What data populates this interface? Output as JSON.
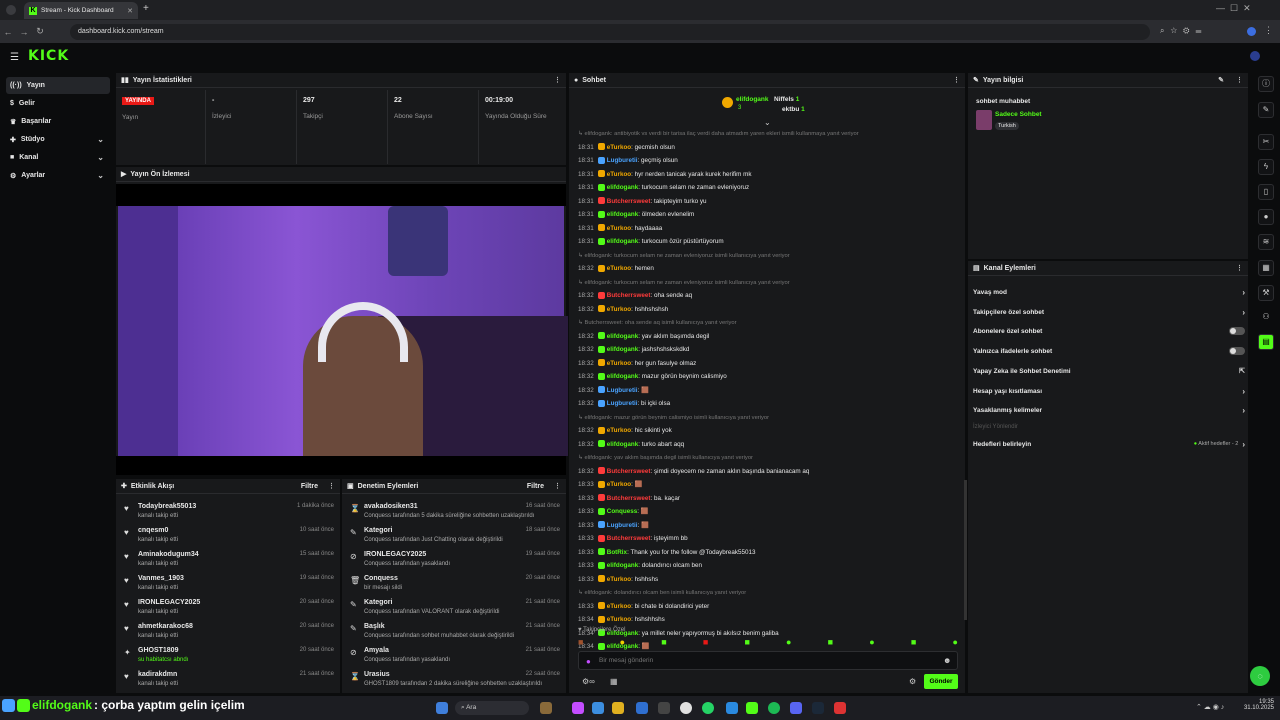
{
  "browser": {
    "tab_title": "Stream - Kick Dashboard",
    "url": "dashboard.kick.com/stream"
  },
  "brand": {
    "logo": "KICK",
    "accent": "#53fc18"
  },
  "sidebar": {
    "items": [
      {
        "label": "Yayın",
        "icon": "broadcast-icon"
      },
      {
        "label": "Gelir",
        "icon": "money-icon"
      },
      {
        "label": "Başarılar",
        "icon": "trophy-icon"
      },
      {
        "label": "Stüdyo",
        "icon": "studio-icon"
      },
      {
        "label": "Kanal",
        "icon": "channel-icon"
      },
      {
        "label": "Ayarlar",
        "icon": "gear-icon"
      }
    ]
  },
  "stats": {
    "title": "Yayın İstatistikleri",
    "cells": [
      {
        "value": "YAYINDA",
        "label": "Yayın"
      },
      {
        "value": "-",
        "label": "İzleyici"
      },
      {
        "value": "297",
        "label": "Takipçi"
      },
      {
        "value": "22",
        "label": "Abone Sayısı"
      },
      {
        "value": "00:19:00",
        "label": "Yayında Olduğu Süre"
      }
    ]
  },
  "preview": {
    "title": "Yayın Ön İzlemesi"
  },
  "activity": {
    "title": "Etkinlik Akışı",
    "filter": "Filtre",
    "rows": [
      {
        "name": "Todaybreak55013",
        "sub": "kanalı takip etti",
        "time": "1 dakika önce"
      },
      {
        "name": "cnqesm0",
        "sub": "kanalı takip etti",
        "time": "10 saat önce"
      },
      {
        "name": "Aminakodugum34",
        "sub": "kanalı takip etti",
        "time": "15 saat önce"
      },
      {
        "name": "Vanmes_1903",
        "sub": "kanalı takip etti",
        "time": "19 saat önce"
      },
      {
        "name": "IRONLEGACY2025",
        "sub": "kanalı takip etti",
        "time": "20 saat önce"
      },
      {
        "name": "ahmetkarakoc68",
        "sub": "kanalı takip etti",
        "time": "20 saat önce"
      },
      {
        "name": "GHOST1809",
        "sub": "su habitatcsı abndı",
        "time": "20 saat önce"
      },
      {
        "name": "kadirakdmn",
        "sub": "kanalı takip etti",
        "time": "21 saat önce"
      }
    ]
  },
  "moderation": {
    "title": "Denetim Eylemleri",
    "filter": "Filtre",
    "rows": [
      {
        "name": "avakadosiken31",
        "sub": "Conquess tarafından 5 dakika süreliğine sohbetten uzaklaştırıldı",
        "time": "16 saat önce"
      },
      {
        "name": "Kategori",
        "sub": "Conquess tarafından Just Chatting olarak değiştirildi",
        "time": "18 saat önce"
      },
      {
        "name": "IRONLEGACY2025",
        "sub": "Conquess tarafından yasaklandı",
        "time": "19 saat önce"
      },
      {
        "name": "Conquess",
        "sub": "bir mesajı sildi",
        "time": "20 saat önce"
      },
      {
        "name": "Kategori",
        "sub": "Conquess tarafından VALORANT olarak değiştirildi",
        "time": "21 saat önce"
      },
      {
        "name": "Başlık",
        "sub": "Conquess tarafından sohbet muhabbet olarak değiştirildi",
        "time": "21 saat önce"
      },
      {
        "name": "Amyala",
        "sub": "Conquess tarafından yasaklandı",
        "time": "21 saat önce"
      },
      {
        "name": "Urasius",
        "sub": "GHOST1809 tarafından 2 dakika süreliğine sohbetten uzaklaştırıldı",
        "time": "22 saat önce"
      }
    ]
  },
  "chat": {
    "title": "Sohbet",
    "pinned_user": "elifdogank",
    "pinned_count": "3",
    "top1": "Niffels",
    "top1n": "1",
    "top2": "ektbu",
    "top2n": "1",
    "followers_only": "Takipçilere Özel",
    "placeholder": "Bir mesaj gönderin",
    "send": "Gönder",
    "lines": [
      {
        "r": "elifdogank: antibiyotik vs verdi bir tarisa ilaç verdi daha atmadım yaren ekleri ismili kullanmaya yanıt veriyor"
      },
      {
        "t": "18:31",
        "u": "eTurkoo",
        "c": "#f0a800",
        "m": "gecmish olsun"
      },
      {
        "t": "18:31",
        "u": "Lugburetii",
        "c": "#4aa3ff",
        "m": "geçmiş olsun"
      },
      {
        "t": "18:31",
        "u": "eTurkoo",
        "c": "#f0a800",
        "m": "hyr nerden tanicak yarak kurek herifim mk"
      },
      {
        "t": "18:31",
        "u": "elifdogank",
        "c": "#53fc18",
        "m": "turkocum selam ne zaman evleniyoruz"
      },
      {
        "t": "18:31",
        "u": "Butcherrsweet",
        "c": "#ff3b3b",
        "m": "takipteyim turko yu"
      },
      {
        "t": "18:31",
        "u": "elifdogank",
        "c": "#53fc18",
        "m": "ölmeden evlenelim"
      },
      {
        "t": "18:31",
        "u": "eTurkoo",
        "c": "#f0a800",
        "m": "haydaaaa"
      },
      {
        "t": "18:31",
        "u": "elifdogank",
        "c": "#53fc18",
        "m": "turkocum özür püstürtüyorum"
      },
      {
        "r": "elifdogank: turkocum selam ne zaman evleniyoruz isimli kullanıcıya yanıt veriyor"
      },
      {
        "t": "18:32",
        "u": "eTurkoo",
        "c": "#f0a800",
        "m": "hemen"
      },
      {
        "r": "elifdogank: turkocum selam ne zaman evleniyoruz isimli kullanıcıya yanıt veriyor"
      },
      {
        "t": "18:32",
        "u": "Butcherrsweet",
        "c": "#ff3b3b",
        "m": "oha sende aq"
      },
      {
        "t": "18:32",
        "u": "eTurkoo",
        "c": "#f0a800",
        "m": "hshhshshsh"
      },
      {
        "r": "Butcherrsweet: oha sende aq isimli kullanıcıya yanıt veriyor"
      },
      {
        "t": "18:32",
        "u": "elifdogank",
        "c": "#53fc18",
        "m": "yav aklım başımda degil"
      },
      {
        "t": "18:32",
        "u": "elifdogank",
        "c": "#53fc18",
        "m": "jashshshskskdkd"
      },
      {
        "t": "18:32",
        "u": "eTurkoo",
        "c": "#f0a800",
        "m": "her gun fasulye olmaz"
      },
      {
        "t": "18:32",
        "u": "elifdogank",
        "c": "#53fc18",
        "m": "mazur görün beynim calismiyo"
      },
      {
        "t": "18:32",
        "u": "Lugburetii",
        "c": "#4aa3ff",
        "m": "🟫"
      },
      {
        "t": "18:32",
        "u": "Lugburetii",
        "c": "#4aa3ff",
        "m": "bi içki olsa"
      },
      {
        "r": "elifdogank: mazur görün beynim calismiyo isimli kullanıcıya yanıt veriyor"
      },
      {
        "t": "18:32",
        "u": "eTurkoo",
        "c": "#f0a800",
        "m": "hic sikinti yok"
      },
      {
        "t": "18:32",
        "u": "elifdogank",
        "c": "#53fc18",
        "m": "turko abart aqq"
      },
      {
        "r": "elifdogank: yav aklım başımda degil isimli kullanıcıya yanıt veriyor"
      },
      {
        "t": "18:32",
        "u": "Butcherrsweet",
        "c": "#ff3b3b",
        "m": "şimdi doyecem ne zaman aklın başında banianacam aq"
      },
      {
        "t": "18:33",
        "u": "eTurkoo",
        "c": "#f0a800",
        "m": "🟫"
      },
      {
        "t": "18:33",
        "u": "Butcherrsweet",
        "c": "#ff3b3b",
        "m": "ba. kaçar"
      },
      {
        "t": "18:33",
        "u": "Conquess",
        "c": "#53fc18",
        "m": "🟫"
      },
      {
        "t": "18:33",
        "u": "Lugburetii",
        "c": "#4aa3ff",
        "m": "🟫"
      },
      {
        "t": "18:33",
        "u": "Butcherrsweet",
        "c": "#ff3b3b",
        "m": "işteyimm bb"
      },
      {
        "t": "18:33",
        "u": "BotRix",
        "c": "#53fc18",
        "m": "Thank you for the follow @Todaybreak55013"
      },
      {
        "t": "18:33",
        "u": "elifdogank",
        "c": "#53fc18",
        "m": "dolandırıcı olcam ben"
      },
      {
        "t": "18:33",
        "u": "eTurkoo",
        "c": "#f0a800",
        "m": "hshhshs"
      },
      {
        "r": "elifdogank: dolandırıcı olcam ben isimli kullanıcıya yanıt veriyor"
      },
      {
        "t": "18:33",
        "u": "eTurkoo",
        "c": "#f0a800",
        "m": "bi chate bi dolandirici yeter"
      },
      {
        "t": "18:34",
        "u": "eTurkoo",
        "c": "#f0a800",
        "m": "hshshhshs"
      },
      {
        "t": "18:34",
        "u": "elifdogank",
        "c": "#53fc18",
        "m": "ya millet neler yapıyormuş bi akılsız benim galiba"
      },
      {
        "t": "18:34",
        "u": "elifdogank",
        "c": "#53fc18",
        "m": "🟫"
      },
      {
        "t": "18:34",
        "u": "elifdogank",
        "c": "#53fc18",
        "m": "çorba yaptım gelin içelim"
      }
    ]
  },
  "info": {
    "title": "Yayın bilgisi",
    "stream_title": "sohbet muhabbet",
    "category": "Sadece Sohbet",
    "tag": "Turkish"
  },
  "actions": {
    "title": "Kanal Eylemleri",
    "rows": [
      {
        "label": "Yavaş mod",
        "kind": "arrow"
      },
      {
        "label": "Takipçilere özel sohbet",
        "kind": "arrow"
      },
      {
        "label": "Abonelere özel sohbet",
        "kind": "toggle"
      },
      {
        "label": "Yalnızca ifadelerle sohbet",
        "kind": "toggle"
      },
      {
        "label": "Yapay Zeka ile Sohbet Denetimi",
        "kind": "ext"
      },
      {
        "label": "Hesap yaşı kısıtlaması",
        "kind": "arrow"
      },
      {
        "label": "Yasaklanmış kelimeler",
        "kind": "arrow"
      }
    ],
    "section": "İzleyici Yönlendir",
    "goal": "Hedefleri belirleyin",
    "goal_status": "Aktif hedefler - 2"
  },
  "overlay": {
    "user": "elifdogank",
    "message": ": çorba yaptım gelin içelim"
  },
  "taskbar": {
    "search": "Ara",
    "time": "19:35",
    "date": "31.10.2025"
  }
}
